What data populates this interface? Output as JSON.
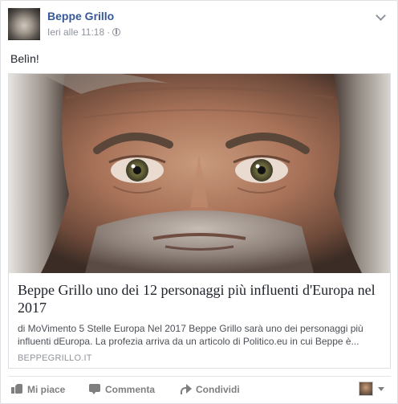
{
  "post": {
    "author": "Beppe Grillo",
    "timestamp": "Ieri alle 11:18",
    "separator": "·",
    "privacy_icon": "globe-icon",
    "menu_icon": "chevron-down-icon",
    "message": "Belìn!"
  },
  "attachment": {
    "title": "Beppe Grillo uno dei 12 personaggi più influenti d'Europa nel 2017",
    "description": "di MoVimento 5 Stelle Europa Nel 2017 Beppe Grillo sarà uno dei personaggi più influenti dEuropa. La profezia arriva da un articolo di Politico.eu in cui Beppe è...",
    "domain": "BEPPEGRILLO.IT"
  },
  "actions": {
    "like_label": "Mi piace",
    "like_icon": "thumbs-up-icon",
    "comment_label": "Commenta",
    "comment_icon": "comment-icon",
    "share_label": "Condividi",
    "share_icon": "share-icon"
  },
  "colors": {
    "author_link": "#365899",
    "meta_text": "#90949c",
    "action_text": "#7f7f7f",
    "border": "#dddfe2"
  }
}
